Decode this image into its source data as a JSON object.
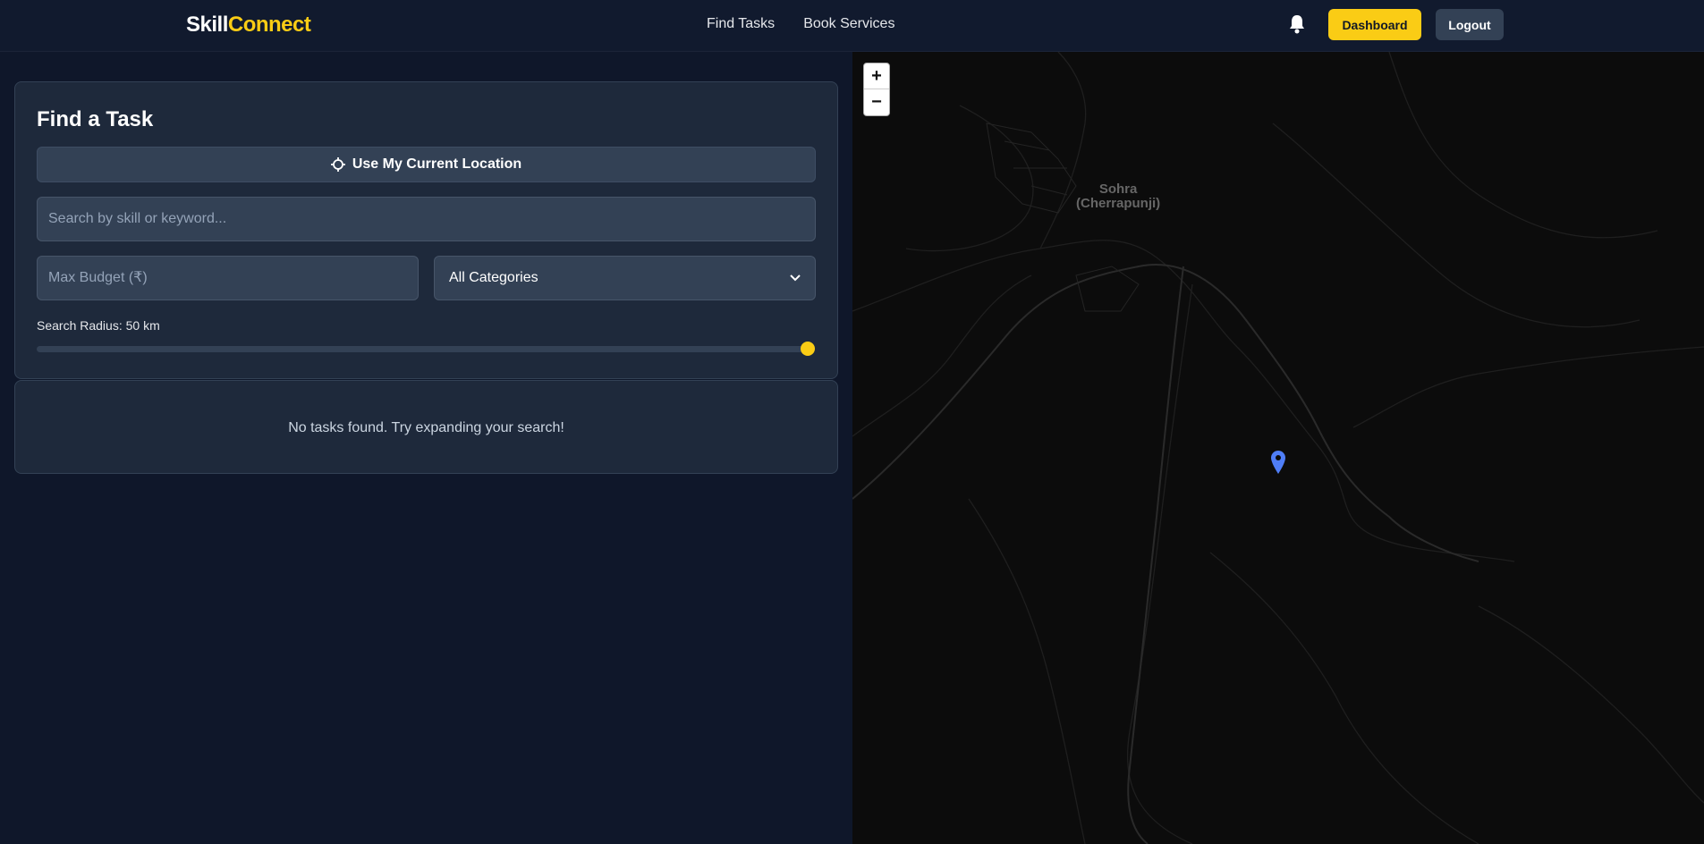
{
  "nav": {
    "brand_part1": "Skill",
    "brand_part2": "Connect",
    "links": [
      "Find Tasks",
      "Book Services"
    ],
    "dashboard_label": "Dashboard",
    "logout_label": "Logout",
    "icons": [
      "bell-icon"
    ]
  },
  "panel": {
    "title": "Find a Task",
    "location_button": "Use My Current Location",
    "search_placeholder": "Search by skill or keyword...",
    "budget_placeholder": "Max Budget (₹)",
    "category_selected": "All Categories",
    "radius_label": "Search Radius: 50 km",
    "radius_fraction": 1.0
  },
  "results": {
    "empty_message": "No tasks found. Try expanding your search!"
  },
  "map": {
    "zoom_in": "+",
    "zoom_out": "−",
    "place_line1": "Sohra",
    "place_line2": "(Cherrapunji)"
  },
  "colors": {
    "accent": "#facc15",
    "background": "#0f172a",
    "panel": "#1e293b",
    "marker": "#4f7ef7"
  }
}
